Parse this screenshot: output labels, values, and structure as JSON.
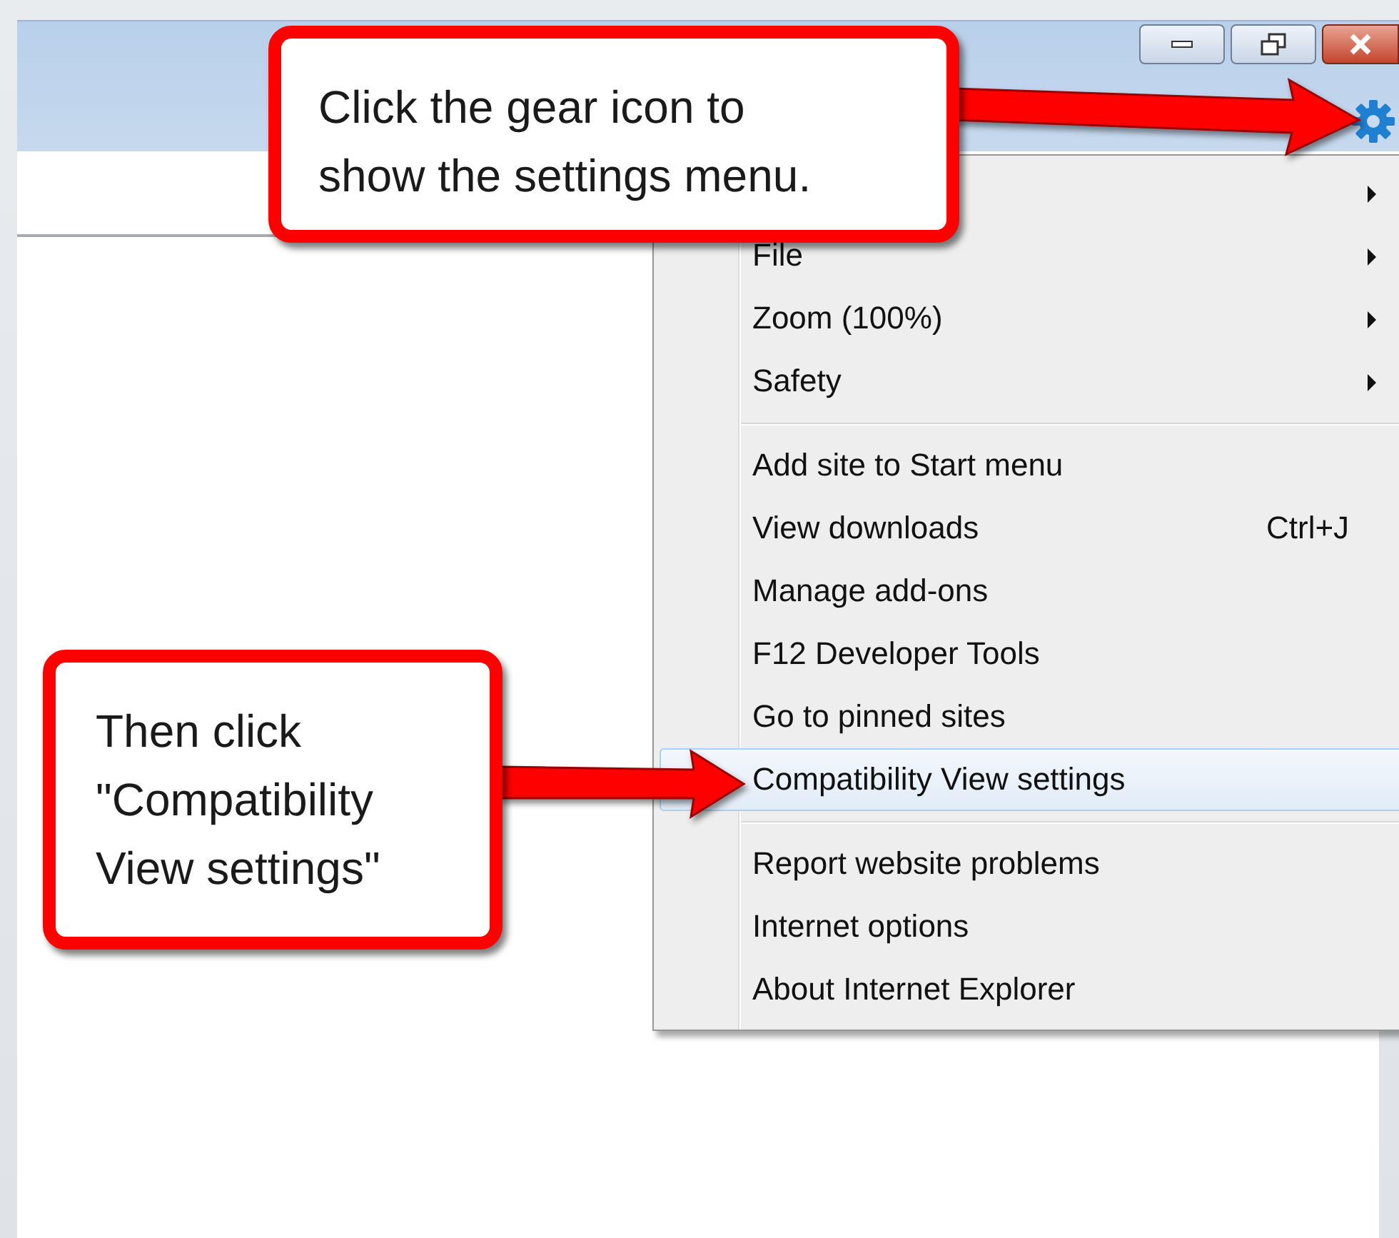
{
  "window": {
    "controls": [
      {
        "kind": "minimize"
      },
      {
        "kind": "restore"
      },
      {
        "kind": "close"
      }
    ]
  },
  "menu": {
    "items": [
      {
        "kind": "item",
        "submenu": true,
        "selected": false
      },
      {
        "kind": "item",
        "label": "File",
        "submenu": true,
        "selected": false
      },
      {
        "kind": "item",
        "label": "Zoom (100%)",
        "submenu": true,
        "selected": false
      },
      {
        "kind": "item",
        "label": "Safety",
        "submenu": true,
        "selected": false
      },
      {
        "kind": "separator"
      },
      {
        "kind": "item",
        "label": "Add site to Start menu",
        "submenu": false,
        "selected": false
      },
      {
        "kind": "item",
        "label": "View downloads",
        "shortcut": "Ctrl+J",
        "submenu": false,
        "selected": false
      },
      {
        "kind": "item",
        "label": "Manage add-ons",
        "submenu": false,
        "selected": false
      },
      {
        "kind": "item",
        "label": "F12 Developer Tools",
        "submenu": false,
        "selected": false
      },
      {
        "kind": "item",
        "label": "Go to pinned sites",
        "submenu": false,
        "selected": false
      },
      {
        "kind": "item",
        "label": "Compatibility View settings",
        "submenu": false,
        "selected": true
      },
      {
        "kind": "separator"
      },
      {
        "kind": "item",
        "label": "Report website problems",
        "submenu": false,
        "selected": false
      },
      {
        "kind": "item",
        "label": "Internet options",
        "submenu": false,
        "selected": false
      },
      {
        "kind": "item",
        "label": "About Internet Explorer",
        "submenu": false,
        "selected": false
      }
    ]
  },
  "callouts": [
    {
      "text": "Click the gear icon to\nshow the settings menu."
    },
    {
      "text": "Then click\n\"Compatibility\nView settings\""
    }
  ]
}
